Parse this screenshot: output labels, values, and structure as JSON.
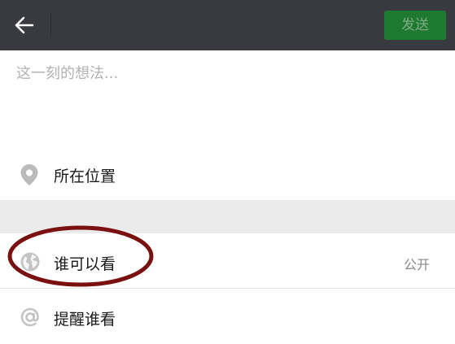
{
  "header": {
    "back_icon": "arrow-left-icon",
    "send_label": "发送"
  },
  "compose": {
    "placeholder": "这一刻的想法..."
  },
  "location": {
    "icon": "location-pin-icon",
    "label": "所在位置"
  },
  "visibility": {
    "icon": "globe-icon",
    "label": "谁可以看",
    "value": "公开"
  },
  "remind": {
    "icon": "at-icon",
    "label": "提醒谁看"
  },
  "colors": {
    "topbar": "#393a3f",
    "send_button": "#1f7a31",
    "annotation_ring": "#7a1010"
  }
}
